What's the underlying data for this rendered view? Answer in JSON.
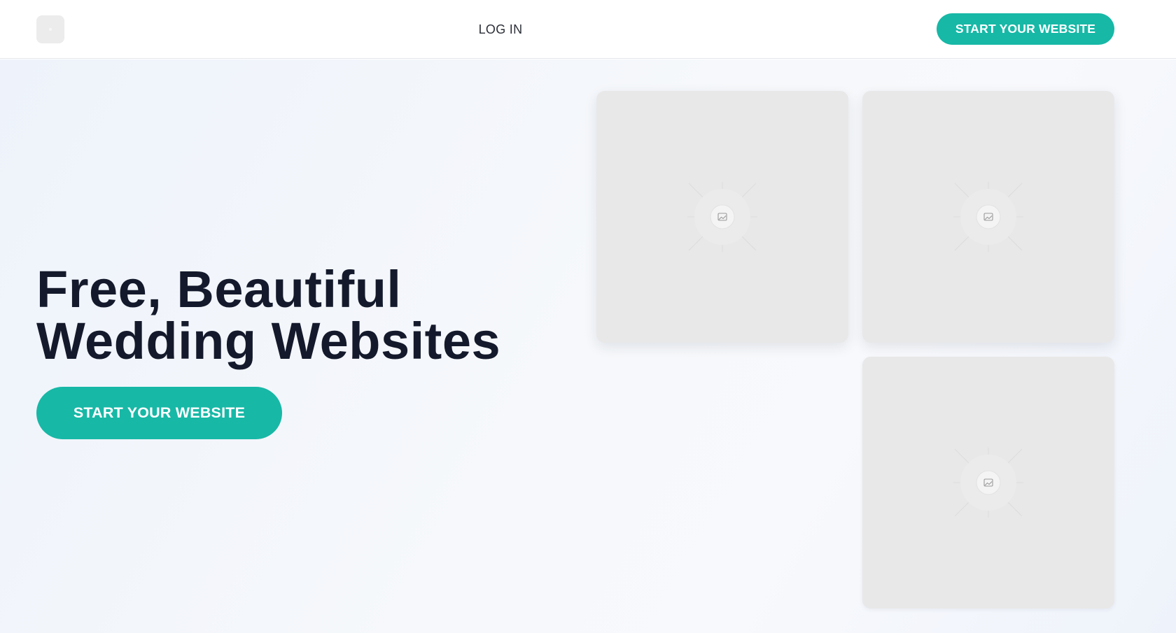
{
  "header": {
    "logo_icon": "logo-icon",
    "login_label": "LOG IN",
    "cta_label": "START YOUR WEBSITE"
  },
  "hero": {
    "headline_line1": "Free, Beautiful",
    "headline_line2": "Wedding Websites",
    "cta_label": "START YOUR WEBSITE"
  },
  "gallery": {
    "placeholder_icon": "image-placeholder-icon",
    "count": 3
  },
  "colors": {
    "accent": "#17b8a6",
    "headline": "#141a2b",
    "placeholder_bg": "#e8e8e8",
    "hero_bg": "#eef3fb"
  }
}
